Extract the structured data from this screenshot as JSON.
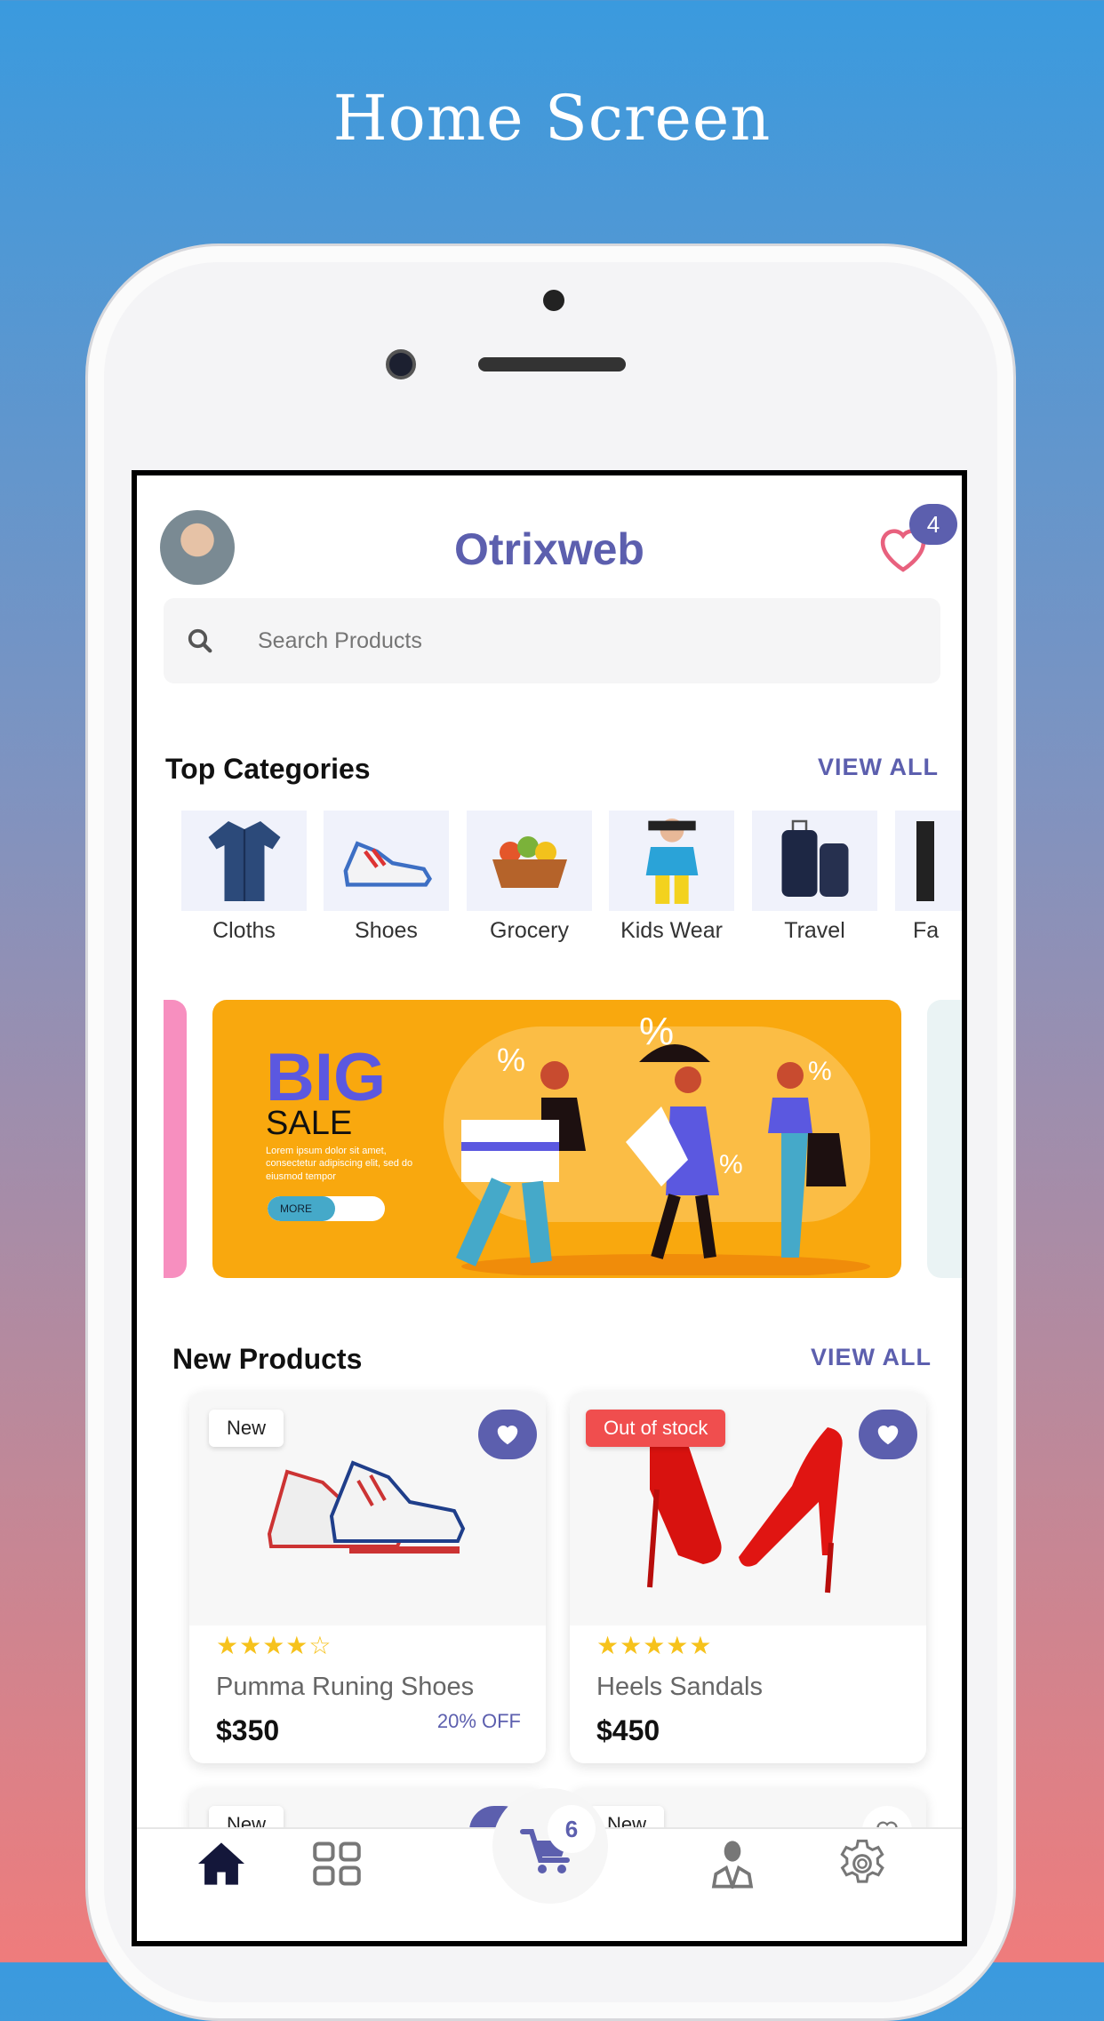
{
  "page_title": "Home Screen",
  "header": {
    "brand": "Otrixweb",
    "wishlist_count": "4"
  },
  "search": {
    "placeholder": "Search Products"
  },
  "categories": {
    "title": "Top Categories",
    "view_all": "VIEW ALL",
    "items": [
      {
        "label": "Cloths"
      },
      {
        "label": "Shoes"
      },
      {
        "label": "Grocery"
      },
      {
        "label": "Kids Wear"
      },
      {
        "label": "Travel"
      },
      {
        "label": "Fa"
      }
    ]
  },
  "banner": {
    "big": "BIG",
    "sale": "SALE",
    "text": "Lorem ipsum dolor sit amet, consectetur adipiscing elit, sed do eiusmod tempor",
    "button": "MORE"
  },
  "new_products": {
    "title": "New Products",
    "view_all": "VIEW ALL",
    "items": [
      {
        "badge": "New",
        "name": "Pumma Runing Shoes",
        "price": "$350",
        "discount": "20% OFF",
        "rating": 4,
        "stars": "★★★★☆"
      },
      {
        "badge": "Out of stock",
        "name": "Heels Sandals",
        "price": "$450",
        "discount": "",
        "rating": 4.5,
        "stars": "★★★★★"
      },
      {
        "badge": "New"
      },
      {
        "badge": "New"
      }
    ]
  },
  "bottom_nav": {
    "cart_count": "6",
    "items": [
      "home",
      "categories",
      "cart",
      "profile",
      "settings"
    ]
  },
  "colors": {
    "accent": "#5c5fae",
    "out_of_stock": "#f04e4e",
    "star": "#f6c21c",
    "banner": "#f9a80e"
  }
}
